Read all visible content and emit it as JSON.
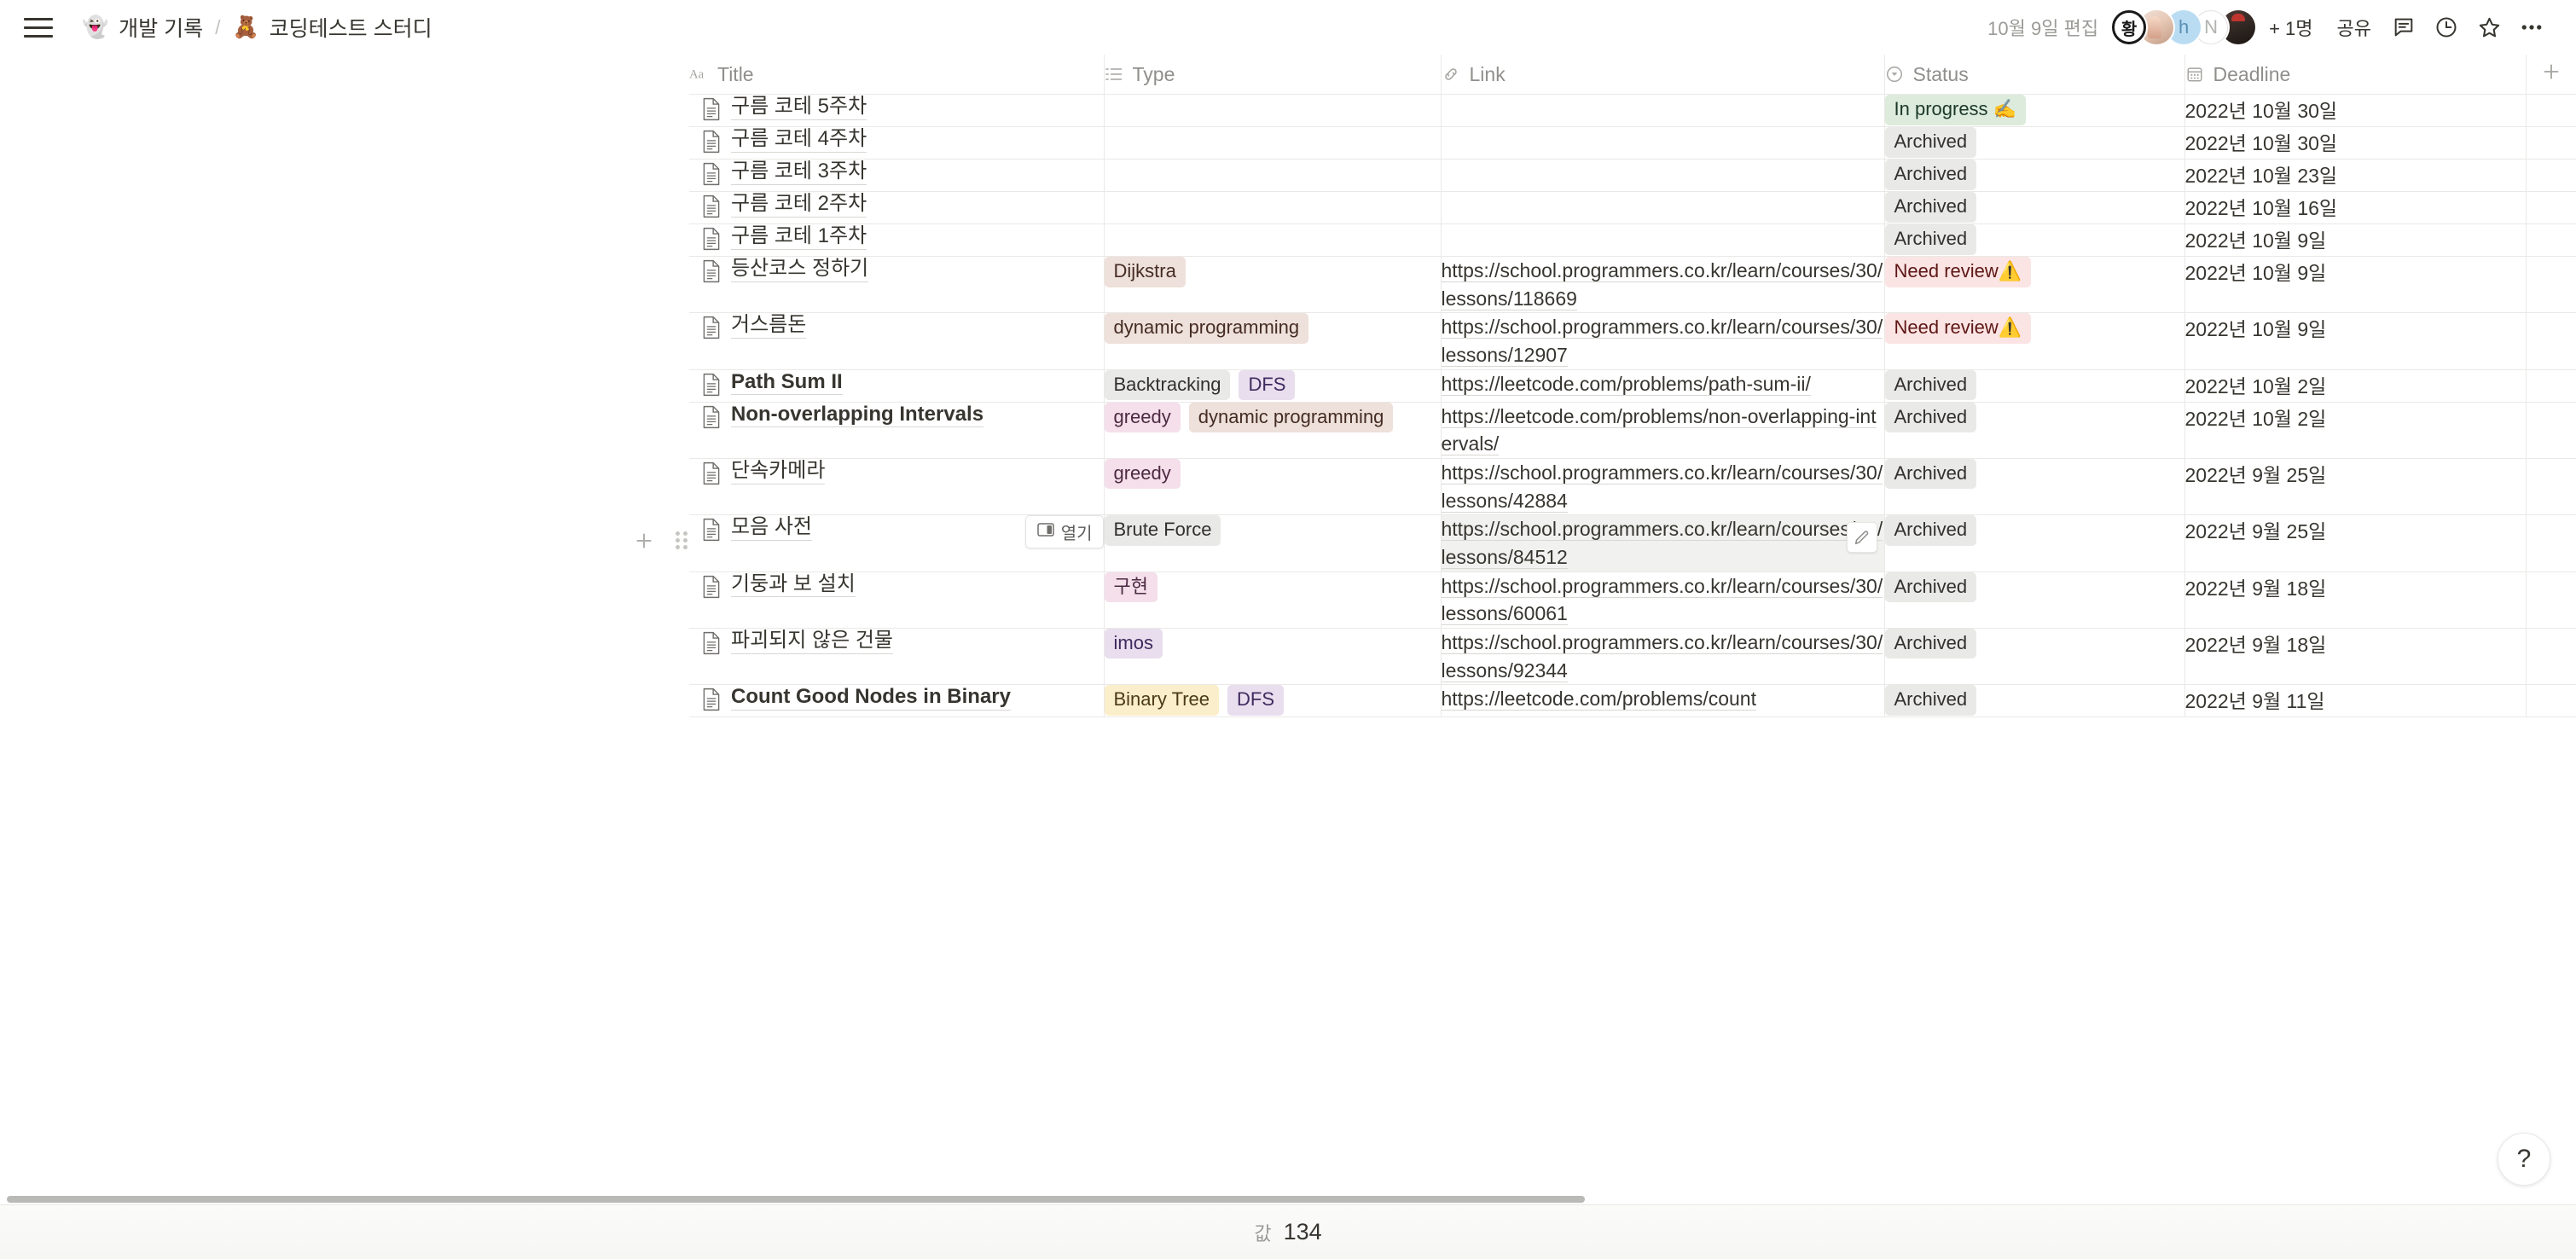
{
  "topbar": {
    "menu_icon": "hamburger-menu-icon",
    "breadcrumb": {
      "parent_emoji": "👻",
      "parent_label": "개발 기록",
      "separator": "/",
      "current_emoji": "🧸",
      "current_label": "코딩테스트 스터디"
    },
    "edited_text": "10월 9일 편집",
    "avatars": [
      {
        "name": "current-user-avatar",
        "initial": "황"
      },
      {
        "name": "collaborator-avatar-1",
        "initial": ""
      },
      {
        "name": "collaborator-avatar-2",
        "initial": "h"
      },
      {
        "name": "collaborator-avatar-3",
        "initial": "N"
      },
      {
        "name": "collaborator-avatar-4",
        "initial": ""
      }
    ],
    "more_members": "+ 1명",
    "share_label": "공유",
    "comment_icon": "comment-icon",
    "history_icon": "clock-history-icon",
    "favorite_icon": "star-icon",
    "more_icon": "more-horizontal-icon"
  },
  "table": {
    "columns": [
      {
        "label": "Title",
        "icon": "text-aa-icon",
        "name": "column-header-title"
      },
      {
        "label": "Type",
        "icon": "multi-select-icon",
        "name": "column-header-type"
      },
      {
        "label": "Link",
        "icon": "link-icon",
        "name": "column-header-link"
      },
      {
        "label": "Status",
        "icon": "status-select-icon",
        "name": "column-header-status"
      },
      {
        "label": "Deadline",
        "icon": "calendar-icon",
        "name": "column-header-deadline"
      }
    ],
    "add_column_icon": "plus-icon",
    "open_button_label": "열기",
    "open_button_icon": "open-peek-icon",
    "rows": [
      {
        "title": "구름 코테 5주차",
        "bold": false,
        "types": [],
        "link": "",
        "status": {
          "label": "In progress ✍️",
          "color": "green"
        },
        "deadline": "2022년 10월 30일"
      },
      {
        "title": "구름 코테 4주차",
        "bold": false,
        "types": [],
        "link": "",
        "status": {
          "label": "Archived",
          "color": "gray"
        },
        "deadline": "2022년 10월 30일"
      },
      {
        "title": "구름 코테 3주차",
        "bold": false,
        "types": [],
        "link": "",
        "status": {
          "label": "Archived",
          "color": "gray"
        },
        "deadline": "2022년 10월 23일"
      },
      {
        "title": "구름 코테 2주차",
        "bold": false,
        "types": [],
        "link": "",
        "status": {
          "label": "Archived",
          "color": "gray"
        },
        "deadline": "2022년 10월 16일"
      },
      {
        "title": "구름 코테 1주차",
        "bold": false,
        "types": [],
        "link": "",
        "status": {
          "label": "Archived",
          "color": "gray"
        },
        "deadline": "2022년 10월 9일"
      },
      {
        "title": "등산코스 정하기",
        "bold": false,
        "types": [
          {
            "label": "Dijkstra",
            "color": "brown"
          }
        ],
        "link": "https://school.programmers.co.kr/learn/courses/30/lessons/118669",
        "status": {
          "label": "Need review⚠️",
          "color": "red"
        },
        "deadline": "2022년 10월 9일"
      },
      {
        "title": "거스름돈",
        "bold": false,
        "types": [
          {
            "label": "dynamic programming",
            "color": "brown"
          }
        ],
        "link": "https://school.programmers.co.kr/learn/courses/30/lessons/12907",
        "status": {
          "label": "Need review⚠️",
          "color": "red"
        },
        "deadline": "2022년 10월 9일"
      },
      {
        "title": "Path Sum II",
        "bold": true,
        "types": [
          {
            "label": "Backtracking",
            "color": "gray"
          },
          {
            "label": "DFS",
            "color": "purple"
          }
        ],
        "link": "https://leetcode.com/problems/path-sum-ii/",
        "status": {
          "label": "Archived",
          "color": "gray"
        },
        "deadline": "2022년 10월 2일"
      },
      {
        "title": "Non-overlapping Intervals",
        "bold": true,
        "types": [
          {
            "label": "greedy",
            "color": "pink"
          },
          {
            "label": "dynamic programming",
            "color": "brown"
          }
        ],
        "link": "https://leetcode.com/problems/non-overlapping-intervals/",
        "status": {
          "label": "Archived",
          "color": "gray"
        },
        "deadline": "2022년 10월 2일"
      },
      {
        "title": "단속카메라",
        "bold": false,
        "types": [
          {
            "label": "greedy",
            "color": "pink"
          }
        ],
        "link": "https://school.programmers.co.kr/learn/courses/30/lessons/42884",
        "status": {
          "label": "Archived",
          "color": "gray"
        },
        "deadline": "2022년 9월 25일"
      },
      {
        "title": "모음 사전",
        "bold": false,
        "types": [
          {
            "label": "Brute Force",
            "color": "gray"
          }
        ],
        "link": "https://school.programmers.co.kr/learn/courses/30/lessons/84512",
        "status": {
          "label": "Archived",
          "color": "gray"
        },
        "deadline": "2022년 9월 25일",
        "hovered": true
      },
      {
        "title": "기둥과 보 설치",
        "bold": false,
        "types": [
          {
            "label": "구현",
            "color": "pink"
          }
        ],
        "link": "https://school.programmers.co.kr/learn/courses/30/lessons/60061",
        "status": {
          "label": "Archived",
          "color": "gray"
        },
        "deadline": "2022년 9월 18일"
      },
      {
        "title": "파괴되지 않은 건물",
        "bold": false,
        "types": [
          {
            "label": "imos",
            "color": "purple"
          }
        ],
        "link": "https://school.programmers.co.kr/learn/courses/30/lessons/92344",
        "status": {
          "label": "Archived",
          "color": "gray"
        },
        "deadline": "2022년 9월 18일"
      },
      {
        "title": "Count Good Nodes in Binary",
        "bold": true,
        "types": [
          {
            "label": "Binary Tree",
            "color": "yellow"
          },
          {
            "label": "DFS",
            "color": "purple"
          }
        ],
        "link": "https://leetcode.com/problems/count",
        "status": {
          "label": "Archived",
          "color": "gray"
        },
        "deadline": "2022년 9월 11일"
      }
    ]
  },
  "row_gutter": {
    "add_icon": "plus-icon",
    "drag_icon": "drag-handle-icon"
  },
  "footer": {
    "count_label": "값",
    "count_value": "134"
  },
  "help": {
    "label": "?",
    "icon": "question-mark-icon"
  },
  "colors": {
    "text": "#37352f",
    "muted": "#9b9a97",
    "border": "#eae9e7",
    "hover": "#f1f1ef",
    "green": "#dcebdc",
    "red": "#fbe4e4",
    "gray": "#e9e9e7",
    "brown": "#eee0da",
    "purple": "#e8deee",
    "pink": "#f4dfeb",
    "yellow": "#fbeeca"
  }
}
